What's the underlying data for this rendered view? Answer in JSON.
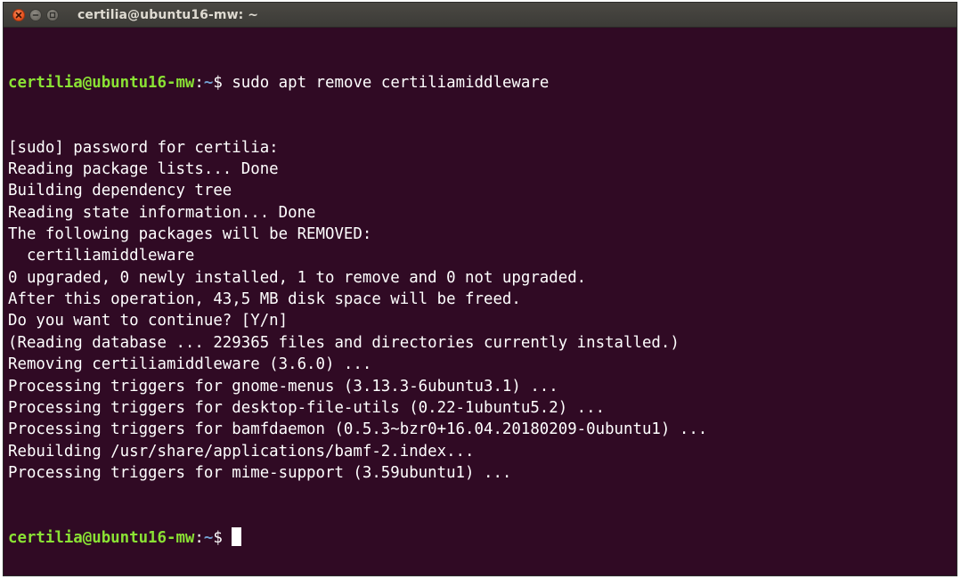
{
  "window": {
    "title": "certilia@ubuntu16-mw: ~"
  },
  "terminal": {
    "first_prompt": {
      "user_host": "certilia@ubuntu16-mw",
      "separator": ":",
      "path": "~",
      "symbol": "$ ",
      "command": "sudo apt remove certiliamiddleware"
    },
    "output_lines": [
      "[sudo] password for certilia:",
      "Reading package lists... Done",
      "Building dependency tree",
      "Reading state information... Done",
      "The following packages will be REMOVED:",
      "  certiliamiddleware",
      "0 upgraded, 0 newly installed, 1 to remove and 0 not upgraded.",
      "After this operation, 43,5 MB disk space will be freed.",
      "Do you want to continue? [Y/n]",
      "(Reading database ... 229365 files and directories currently installed.)",
      "Removing certiliamiddleware (3.6.0) ...",
      "Processing triggers for gnome-menus (3.13.3-6ubuntu3.1) ...",
      "Processing triggers for desktop-file-utils (0.22-1ubuntu5.2) ...",
      "Processing triggers for bamfdaemon (0.5.3~bzr0+16.04.20180209-0ubuntu1) ...",
      "Rebuilding /usr/share/applications/bamf-2.index...",
      "Processing triggers for mime-support (3.59ubuntu1) ..."
    ],
    "last_prompt": {
      "user_host": "certilia@ubuntu16-mw",
      "separator": ":",
      "path": "~",
      "symbol": "$ "
    }
  },
  "colors": {
    "terminal_background": "#300a24",
    "prompt_user": "#8ae234",
    "prompt_path": "#729fcf",
    "close_button": "#e95420"
  },
  "icons": [
    "close-icon",
    "minimize-icon",
    "maximize-icon"
  ]
}
